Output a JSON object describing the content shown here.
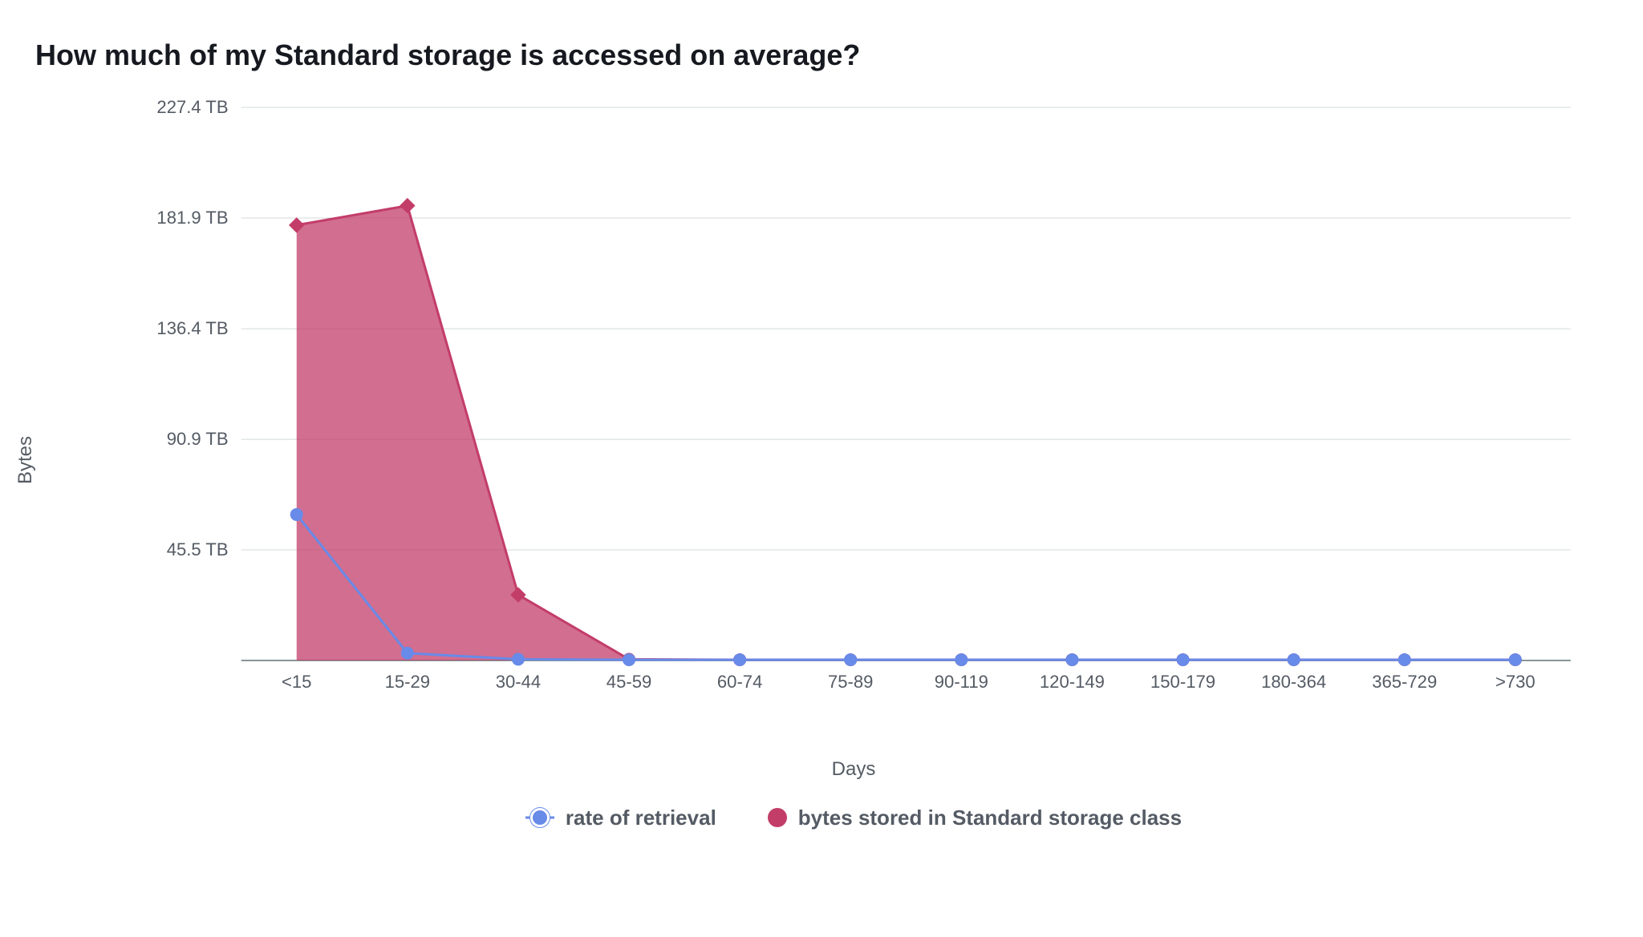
{
  "chart_data": {
    "type": "area",
    "title": "How much of my Standard storage is accessed on average?",
    "xlabel": "Days",
    "ylabel": "Bytes",
    "categories": [
      "<15",
      "15-29",
      "30-44",
      "45-59",
      "60-74",
      "75-89",
      "90-119",
      "120-149",
      "150-179",
      "180-364",
      "365-729",
      ">730"
    ],
    "y_ticks": [
      {
        "value": 0,
        "label": ""
      },
      {
        "value": 45.5,
        "label": "45.5 TB"
      },
      {
        "value": 90.9,
        "label": "90.9 TB"
      },
      {
        "value": 136.4,
        "label": "136.4 TB"
      },
      {
        "value": 181.9,
        "label": "181.9 TB"
      },
      {
        "value": 227.4,
        "label": "227.4 TB"
      }
    ],
    "ylim": [
      0,
      227.4
    ],
    "series": [
      {
        "name": "bytes stored in Standard storage class",
        "style": "area",
        "color": "#c33d69",
        "values_tb": [
          179,
          187,
          27,
          0.5,
          0.3,
          0.3,
          0.3,
          0.3,
          0.3,
          0.3,
          0.3,
          0.3
        ]
      },
      {
        "name": "rate of retrieval",
        "style": "line",
        "color": "#688ae8",
        "values_tb": [
          60,
          3,
          0.5,
          0.3,
          0.3,
          0.3,
          0.3,
          0.3,
          0.3,
          0.3,
          0.3,
          0.3
        ]
      }
    ],
    "legend": [
      {
        "key": "rate of retrieval",
        "style": "line-dot",
        "color": "#688ae8"
      },
      {
        "key": "bytes stored in Standard storage class",
        "style": "dot",
        "color": "#c33d69"
      }
    ]
  }
}
